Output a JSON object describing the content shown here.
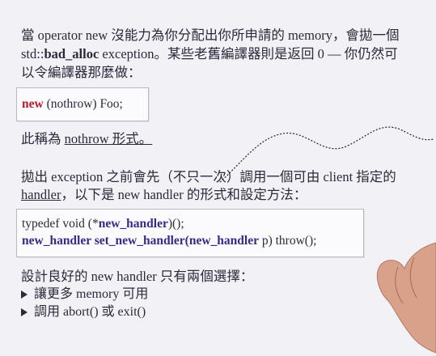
{
  "para1": {
    "line1": "當 operator new 沒能力為你分配出你所申請的 memory，會拋一個",
    "line2_a": "std::",
    "line2_b": "bad_alloc",
    "line2_c": " exception。某些老舊編譯器則是返回 0 — 你仍然可",
    "line3": "以令編譯器那麼做："
  },
  "code1": {
    "kw": "new",
    "rest": " (nothrow) Foo;"
  },
  "para2": {
    "a": "此稱為 ",
    "b": "nothrow",
    "c": " 形式。"
  },
  "para3": {
    "line1": "拋出 exception 之前會先（不只一次）調用一個可由 client 指定的",
    "line2_a": "handler",
    "line2_b": "，以下是 new handler 的形式和設定方法："
  },
  "code2": {
    "l1_a": "typedef void (*",
    "l1_b": "new_handler",
    "l1_c": ")();",
    "l2_a": "new_handler",
    "l2_b": " set_new_handler(",
    "l2_c": "new_handler",
    "l2_d": " p) throw();"
  },
  "para4": {
    "title": "設計良好的 new handler 只有兩個選擇：",
    "bullets": [
      "讓更多 memory 可用",
      "調用 abort() 或 exit()"
    ]
  },
  "colors": {
    "background": "#f2f2f6",
    "text": "#2a2a3a",
    "keyword_red": "#b01e2a",
    "keyword_purple": "#3a2a86",
    "box_border": "#b9b9c4"
  }
}
